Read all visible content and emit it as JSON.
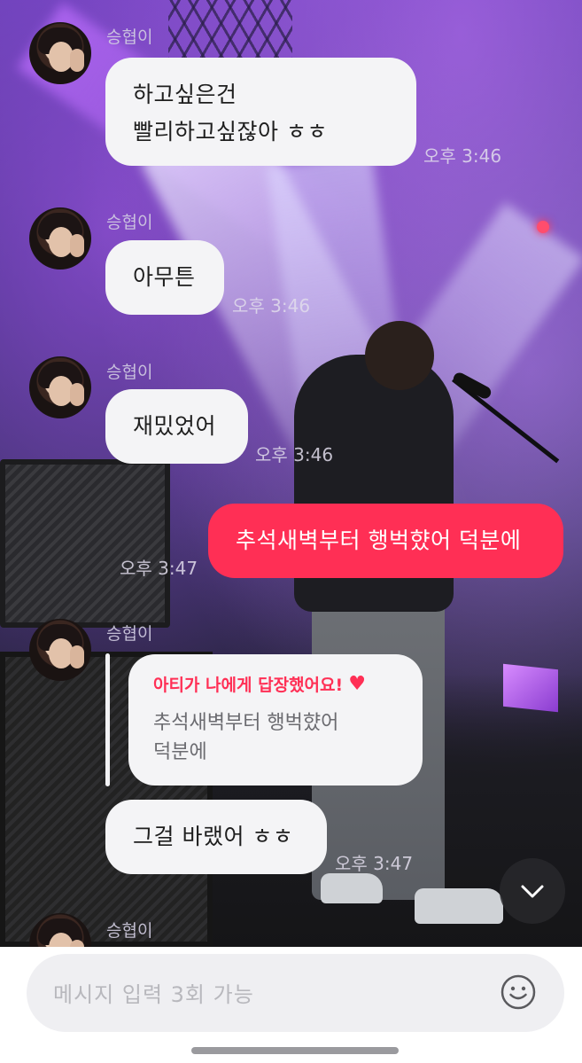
{
  "chat": {
    "messages": [
      {
        "sender": "승협이",
        "text": "하고싶은건\n빨리하고싶잖아 ㅎㅎ",
        "time": "오후 3:46"
      },
      {
        "sender": "승협이",
        "text": "아무튼",
        "time": "오후 3:46"
      },
      {
        "sender": "승협이",
        "text": "재밌었어",
        "time": "오후 3:46"
      },
      {
        "sender": "me",
        "text": "추석새벽부터 행벅햤어 덕분에",
        "time": "오후 3:47"
      },
      {
        "sender": "승협이",
        "reply": {
          "title": "아티가 나에게 답장했어요!",
          "quoted": "추석새벽부터 행벅햤어\n덕분에"
        },
        "text": "그걸 바랬어 ㅎㅎ",
        "time": "오후 3:47"
      },
      {
        "sender": "승협이"
      }
    ]
  },
  "input": {
    "placeholder": "메시지 입력 3회 가능"
  },
  "icons": {
    "scroll_down": "chevron-down-icon",
    "emoji": "smiley-icon",
    "reply_heart": "heart-icon"
  },
  "colors": {
    "accent": "#ff2f55",
    "bubble": "#f4f4f6",
    "input_bg": "#efeff2"
  }
}
